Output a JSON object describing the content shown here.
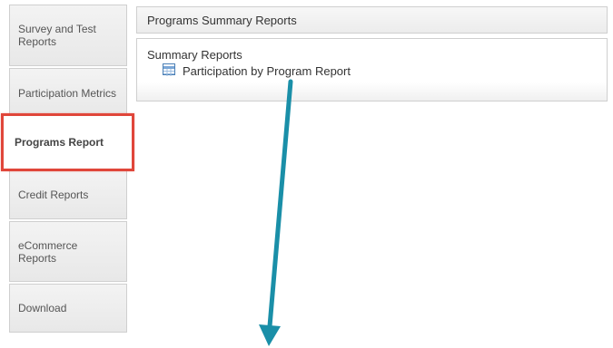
{
  "sidebar": {
    "items": [
      {
        "line1": "Survey and Test",
        "line2": "Reports"
      },
      {
        "line1": "Participation Metrics",
        "line2": ""
      },
      {
        "line1": "Programs Report",
        "line2": ""
      },
      {
        "line1": "Credit Reports",
        "line2": ""
      },
      {
        "line1": "eCommerce",
        "line2": "Reports"
      },
      {
        "line1": "Download",
        "line2": ""
      }
    ],
    "active_index": 2
  },
  "main": {
    "header_title": "Programs Summary Reports",
    "section_title": "Summary Reports",
    "report_link": "Participation by Program Report",
    "report_icon": "table-report-icon"
  },
  "colors": {
    "highlight": "#e0463a",
    "arrow": "#1a8fa8"
  }
}
